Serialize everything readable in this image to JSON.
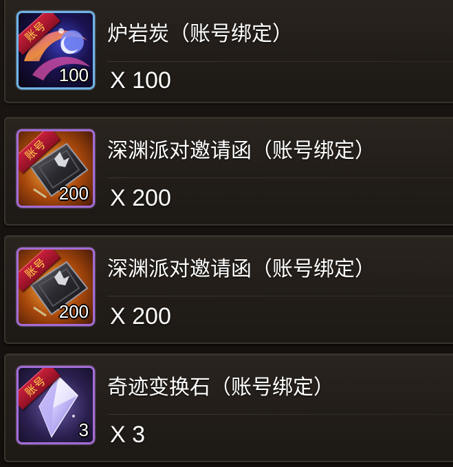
{
  "rewards": [
    {
      "name": "炉岩炭（账号绑定）",
      "quantity_label": "X 100",
      "badge_count": "100",
      "bind_tag": "账号",
      "icon": "lava-charcoal-icon",
      "rarity_color": "#6fb4e6"
    },
    {
      "name": "深渊派对邀请函（账号绑定）",
      "quantity_label": "X 200",
      "badge_count": "200",
      "bind_tag": "账号",
      "icon": "abyss-party-invitation-icon",
      "rarity_color": "#a36cd6"
    },
    {
      "name": "深渊派对邀请函（账号绑定）",
      "quantity_label": "X 200",
      "badge_count": "200",
      "bind_tag": "账号",
      "icon": "abyss-party-invitation-icon",
      "rarity_color": "#a36cd6"
    },
    {
      "name": "奇迹变换石（账号绑定）",
      "quantity_label": "X 3",
      "badge_count": "3",
      "bind_tag": "账号",
      "icon": "miracle-transmute-stone-icon",
      "rarity_color": "#a36cd6"
    }
  ]
}
